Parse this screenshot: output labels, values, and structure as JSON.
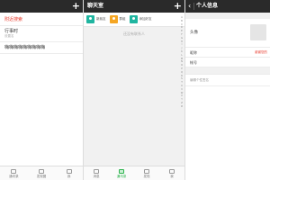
{
  "pane1": {
    "header": {
      "title": "",
      "add_label": "+"
    },
    "red_link": "附近搜索",
    "items": [
      {
        "main": "行事时",
        "sub": "设置名"
      },
      {
        "main": "嗨嗨嗨嗨嗨嗨嗨嗨嗨",
        "sub": ""
      }
    ],
    "tabs": [
      {
        "label": "通讯录",
        "icon": "chat-icon"
      },
      {
        "label": "发现圈",
        "icon": "discover-icon"
      },
      {
        "label": "我",
        "icon": "user-icon"
      }
    ]
  },
  "pane2": {
    "header": {
      "title": "聊天室",
      "add_label": "+"
    },
    "contacts": [
      {
        "name": "新朋友",
        "icon": "new-friend-icon",
        "color": "#1fb5a0"
      },
      {
        "name": "群组",
        "icon": "group-icon",
        "color": "#f5a623"
      },
      {
        "name": "添加好友",
        "icon": "add-friend-icon",
        "color": "#1fb5a0"
      }
    ],
    "empty_hint": "还没有联系人",
    "index_letters": [
      "A",
      "B",
      "C",
      "D",
      "E",
      "F",
      "G",
      "H",
      "I",
      "J",
      "K",
      "L",
      "M",
      "N",
      "O",
      "P",
      "Q",
      "R",
      "S",
      "T",
      "U",
      "V",
      "W",
      "X",
      "Y",
      "Z",
      "#"
    ],
    "tabs": [
      {
        "label": "消息",
        "icon": "message-icon",
        "active": false
      },
      {
        "label": "通讯录",
        "icon": "contacts-icon",
        "active": true
      },
      {
        "label": "发现",
        "icon": "discover-icon",
        "active": false
      },
      {
        "label": "我",
        "icon": "user-icon",
        "active": false
      }
    ]
  },
  "pane3": {
    "header": {
      "title": "个人信息",
      "back_label": "‹"
    },
    "avatar_label": "头像",
    "nickname_label": "昵称",
    "nickname_value": "谢谢您的",
    "account_label": "帐号",
    "signature_placeholder": "编辑个性签名"
  },
  "colors": {
    "accent": "#2bb24c",
    "alert": "#e8392b",
    "header_bg": "#2a2a2a"
  }
}
